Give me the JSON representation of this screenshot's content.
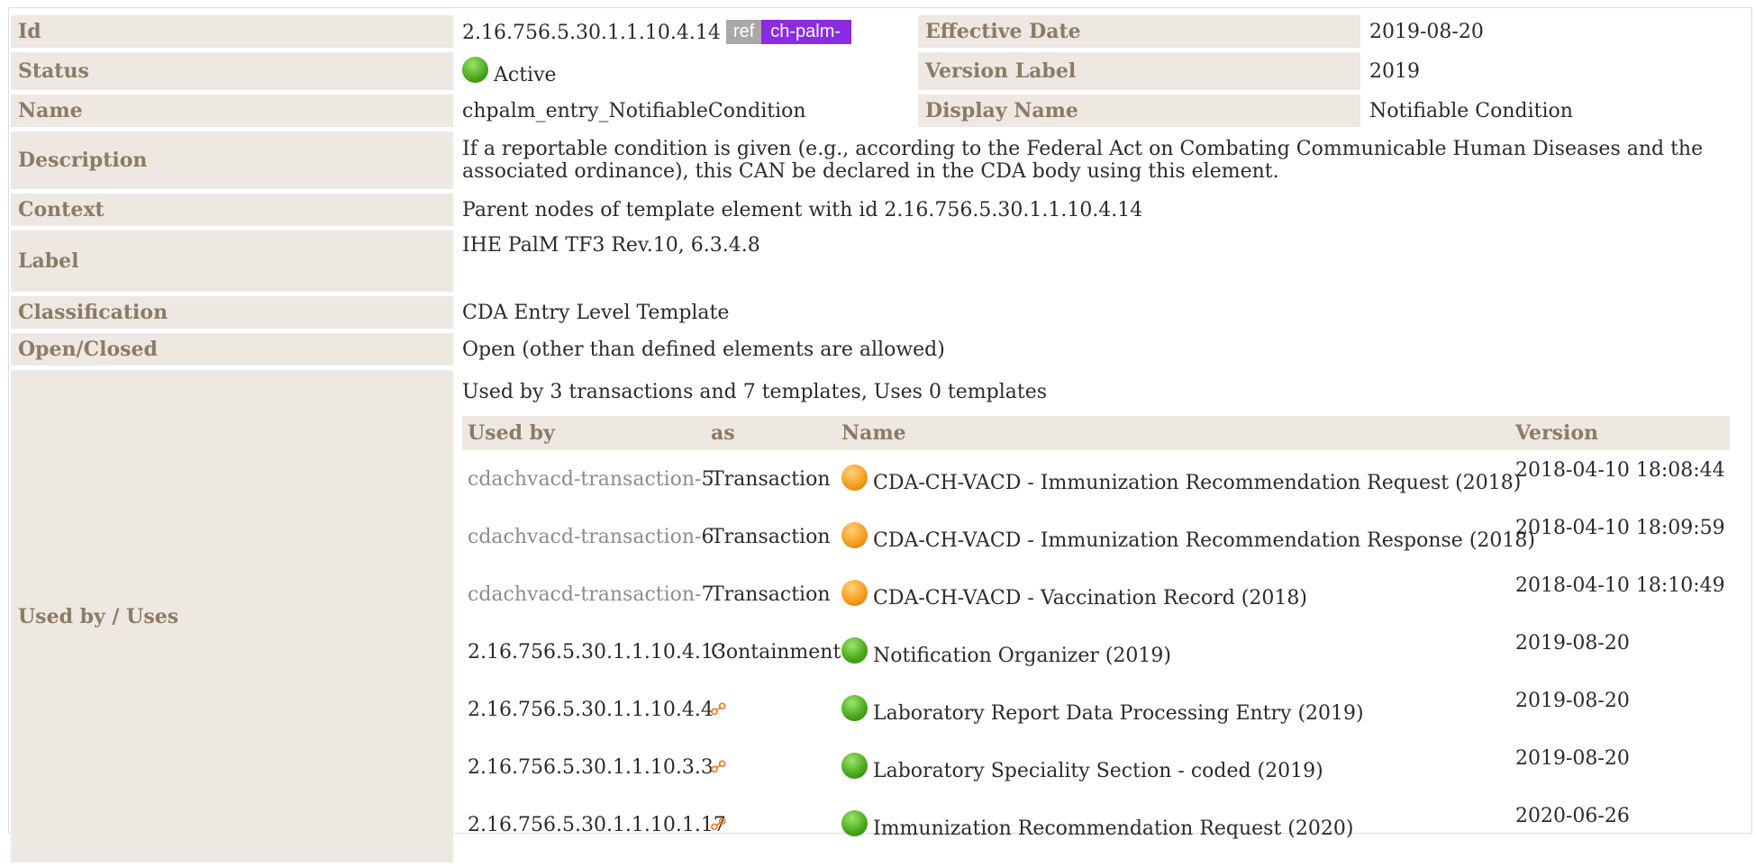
{
  "header": {
    "id_label": "Id",
    "id_value": "2.16.756.5.30.1.1.10.4.14",
    "ref_badge": "ref",
    "prefix_badge": "ch-palm-",
    "effective_date_label": "Effective Date",
    "effective_date_value": "2019-08-20",
    "status_label": "Status",
    "status_value": "Active",
    "version_label_label": "Version Label",
    "version_label_value": "2019",
    "name_label": "Name",
    "name_value": "chpalm_entry_NotifiableCondition",
    "display_name_label": "Display Name",
    "display_name_value": "Notifiable Condition",
    "description_label": "Description",
    "description_value": "If a reportable condition is given (e.g., according to the Federal Act on Combating Communicable Human Diseases and the associated ordinance), this CAN be declared in the CDA body using this element.",
    "context_label": "Context",
    "context_value": "Parent nodes of template element with id 2.16.756.5.30.1.1.10.4.14",
    "label_label": "Label",
    "label_value": "IHE PalM TF3 Rev.10, 6.3.4.8",
    "classification_label": "Classification",
    "classification_value": "CDA Entry Level Template",
    "open_closed_label": "Open/Closed",
    "open_closed_value": "Open (other than defined elements are allowed)",
    "used_by_label": "Used by / Uses"
  },
  "usage": {
    "summary": "Used by 3 transactions and 7 templates, Uses 0 templates",
    "columns": [
      "Used by",
      "as",
      "Name",
      "Version"
    ],
    "rows": [
      {
        "used_by_prefix": "cdachvacd-transaction-",
        "used_by_id": "5",
        "as": "Transaction",
        "status_color": "orange",
        "name": "CDA-CH-VACD - Immunization Recommendation Request (2018)",
        "version": "2018-04-10 18:08:44"
      },
      {
        "used_by_prefix": "cdachvacd-transaction-",
        "used_by_id": "6",
        "as": "Transaction",
        "status_color": "orange",
        "name": "CDA-CH-VACD - Immunization Recommendation Response (2018)",
        "version": "2018-04-10 18:09:59"
      },
      {
        "used_by_prefix": "cdachvacd-transaction-",
        "used_by_id": "7",
        "as": "Transaction",
        "status_color": "orange",
        "name": "CDA-CH-VACD - Vaccination Record (2018)",
        "version": "2018-04-10 18:10:49"
      },
      {
        "used_by_prefix": "",
        "used_by_id": "2.16.756.5.30.1.1.10.4.13",
        "as": "Containment",
        "status_color": "green",
        "name": "Notification Organizer (2019)",
        "version": "2019-08-20"
      },
      {
        "used_by_prefix": "",
        "used_by_id": "2.16.756.5.30.1.1.10.4.4",
        "as": "link-icon",
        "status_color": "green",
        "name": "Laboratory Report Data Processing Entry (2019)",
        "version": "2019-08-20"
      },
      {
        "used_by_prefix": "",
        "used_by_id": "2.16.756.5.30.1.1.10.3.3",
        "as": "link-icon",
        "status_color": "green",
        "name": "Laboratory Speciality Section - coded (2019)",
        "version": "2019-08-20"
      },
      {
        "used_by_prefix": "",
        "used_by_id": "2.16.756.5.30.1.1.10.1.17",
        "as": "link-icon",
        "status_color": "green",
        "name": "Immunization Recommendation Request (2020)",
        "version": "2020-06-26"
      }
    ]
  },
  "colors": {
    "label_bg": "#ede8e1",
    "label_text": "#8c7b66",
    "ref_badge_bg": "#a8a8a8",
    "prefix_badge_bg": "#8b2be2",
    "status_active": "#47a61a",
    "status_draft": "#f59a1b",
    "link_icon": "#e67d23"
  }
}
